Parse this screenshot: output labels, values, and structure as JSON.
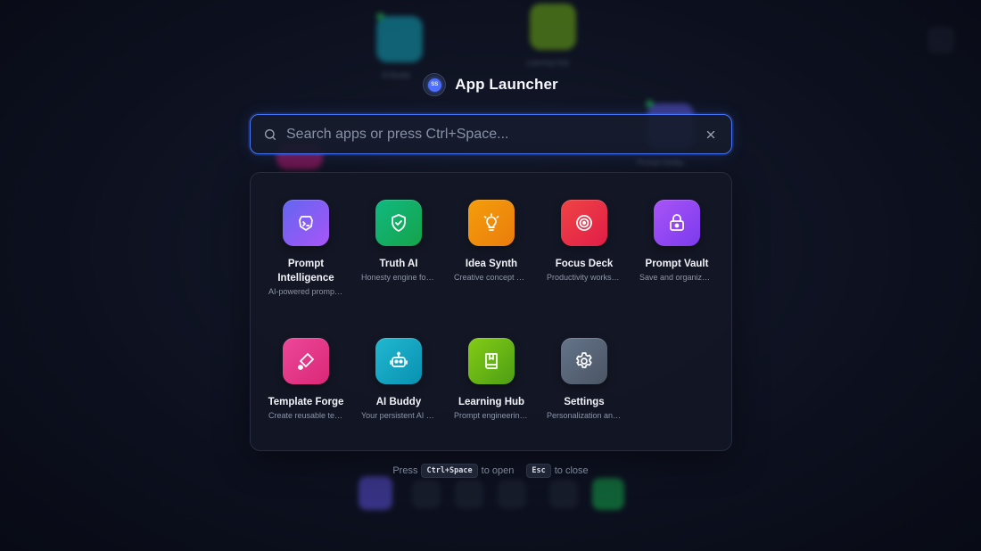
{
  "header": {
    "title": "App Launcher",
    "logo_text": "SS"
  },
  "search": {
    "placeholder": "Search apps or press Ctrl+Space...",
    "value": ""
  },
  "apps": [
    {
      "name": "Prompt Intelligence",
      "desc": "AI-powered prompt analysis",
      "icon": "brain-icon",
      "colors": [
        "#6366f1",
        "#a855f7"
      ]
    },
    {
      "name": "Truth AI",
      "desc": "Honesty engine for AI",
      "icon": "shield-check-icon",
      "colors": [
        "#10b981",
        "#16a34a"
      ]
    },
    {
      "name": "Idea Synth",
      "desc": "Creative concept generator",
      "icon": "lightbulb-icon",
      "colors": [
        "#f59e0b",
        "#ea7c0c"
      ]
    },
    {
      "name": "Focus Deck",
      "desc": "Productivity workspace",
      "icon": "target-icon",
      "colors": [
        "#ef4444",
        "#e11d48"
      ]
    },
    {
      "name": "Prompt Vault",
      "desc": "Save and organize prompts",
      "icon": "lock-icon",
      "colors": [
        "#a855f7",
        "#7c3aed"
      ]
    },
    {
      "name": "Template Forge",
      "desc": "Create reusable templates",
      "icon": "eraser-icon",
      "colors": [
        "#ec4899",
        "#db2777"
      ]
    },
    {
      "name": "AI Buddy",
      "desc": "Your persistent AI companion",
      "icon": "robot-icon",
      "colors": [
        "#22b8cf",
        "#0891b2"
      ]
    },
    {
      "name": "Learning Hub",
      "desc": "Prompt engineering lessons",
      "icon": "book-icon",
      "colors": [
        "#84cc16",
        "#4d9e14"
      ]
    },
    {
      "name": "Settings",
      "desc": "Personalization and preferences",
      "icon": "gear-icon",
      "colors": [
        "#64748b",
        "#4b5563"
      ]
    }
  ],
  "hint": {
    "press": "Press",
    "open_key": "Ctrl+Space",
    "to_open": "to open",
    "close_key": "Esc",
    "to_close": "to close"
  },
  "background": {
    "labels": [
      "AI Buddy",
      "Learning Hub",
      "Prompt Intellig..."
    ]
  }
}
